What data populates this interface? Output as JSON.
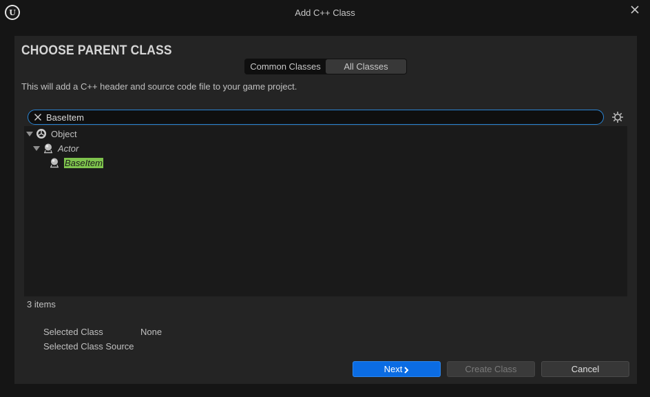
{
  "window": {
    "title": "Add C++ Class",
    "logo_glyph": "U"
  },
  "header": {
    "heading": "CHOOSE PARENT CLASS",
    "description": "This will add a C++ header and source code file to your game project."
  },
  "tabs": [
    {
      "label": "Common Classes",
      "active": false
    },
    {
      "label": "All Classes",
      "active": true
    }
  ],
  "search": {
    "value": "BaseItem",
    "placeholder": ""
  },
  "tree": {
    "items": [
      {
        "label": "Object",
        "icon": "object-class-icon",
        "expanded": true
      },
      {
        "label": "Actor",
        "icon": "actor-class-icon",
        "expanded": true
      },
      {
        "label": "BaseItem",
        "icon": "actor-class-icon",
        "matched": true
      }
    ]
  },
  "footer": {
    "items_count": "3 items",
    "selected_class_label": "Selected Class",
    "selected_class_value": "None",
    "selected_source_label": "Selected Class Source",
    "selected_source_value": ""
  },
  "buttons": {
    "next": "Next",
    "create": "Create Class",
    "cancel": "Cancel"
  },
  "colors": {
    "accent": "#0b6ce3",
    "search_focus": "#2a86d6",
    "match_highlight": "#7ec34d"
  }
}
